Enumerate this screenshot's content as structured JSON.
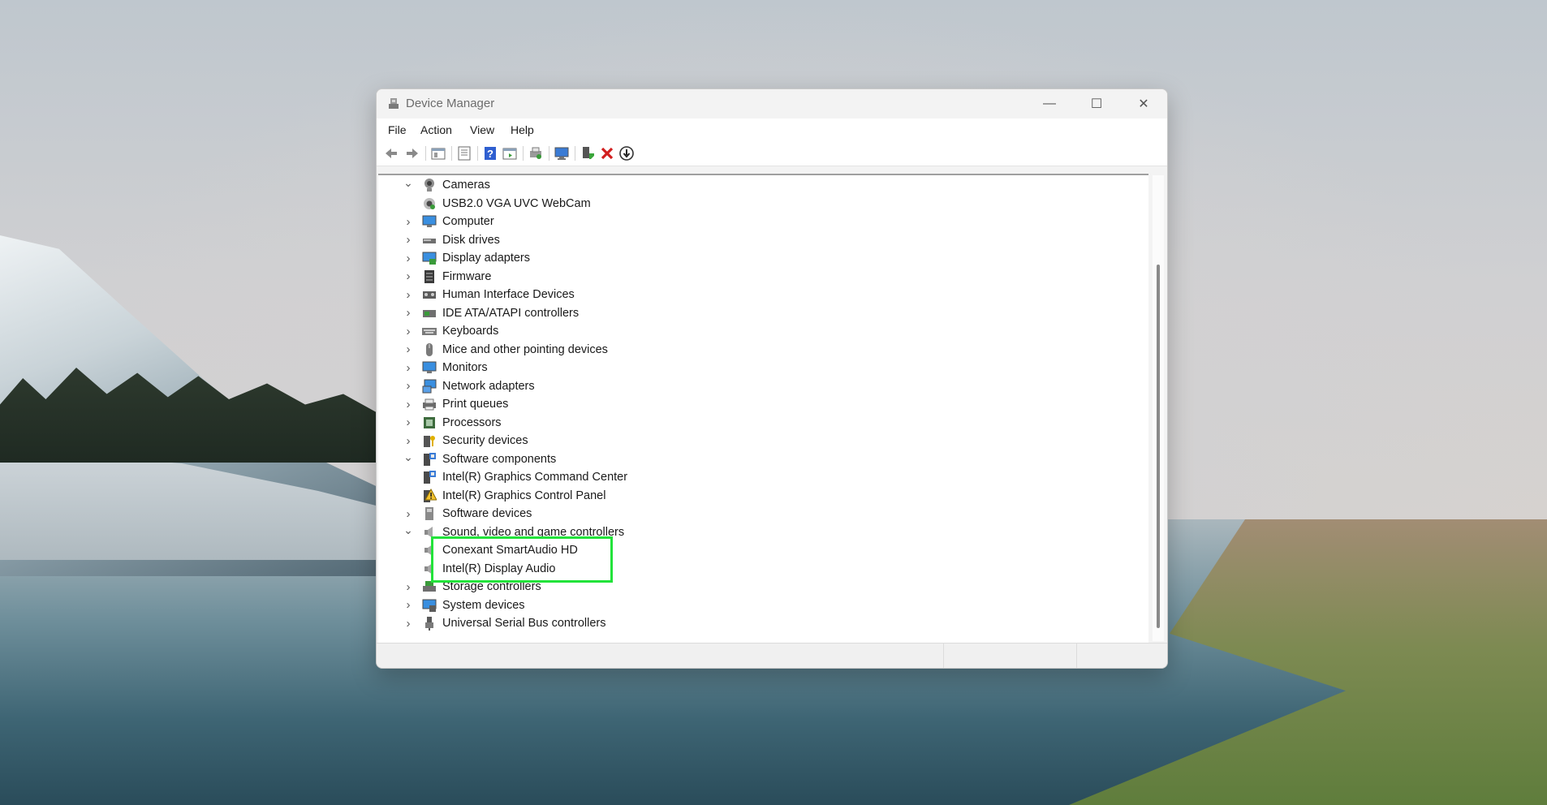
{
  "window": {
    "title": "Device Manager",
    "minimize_glyph": "—",
    "maximize_glyph": "☐",
    "close_glyph": "✕"
  },
  "menu": [
    "File",
    "Action",
    "View",
    "Help"
  ],
  "toolbar": {
    "buttons": [
      "back-arrow-icon",
      "forward-arrow-icon",
      "show-hide-console-tree-icon",
      "properties-icon",
      "help-icon",
      "show-action-pane-icon",
      "print-icon",
      "scan-hardware-icon",
      "update-driver-icon",
      "uninstall-device-icon",
      "disable-device-icon"
    ],
    "colors": {
      "uninstall_red": "#d11f1f"
    }
  },
  "tree": {
    "expanded_glyph": "⌄",
    "collapsed_glyph": "›",
    "items": [
      {
        "label": "Cameras",
        "level": 0,
        "state": "expanded",
        "icon": "camera-icon"
      },
      {
        "label": "USB2.0 VGA UVC WebCam",
        "level": 1,
        "icon": "webcam-icon"
      },
      {
        "label": "Computer",
        "level": 0,
        "state": "collapsed",
        "icon": "computer-icon"
      },
      {
        "label": "Disk drives",
        "level": 0,
        "state": "collapsed",
        "icon": "disk-drive-icon"
      },
      {
        "label": "Display adapters",
        "level": 0,
        "state": "collapsed",
        "icon": "display-adapter-icon"
      },
      {
        "label": "Firmware",
        "level": 0,
        "state": "collapsed",
        "icon": "firmware-icon"
      },
      {
        "label": "Human Interface Devices",
        "level": 0,
        "state": "collapsed",
        "icon": "hid-icon"
      },
      {
        "label": "IDE ATA/ATAPI controllers",
        "level": 0,
        "state": "collapsed",
        "icon": "ide-controller-icon"
      },
      {
        "label": "Keyboards",
        "level": 0,
        "state": "collapsed",
        "icon": "keyboard-icon"
      },
      {
        "label": "Mice and other pointing devices",
        "level": 0,
        "state": "collapsed",
        "icon": "mouse-icon"
      },
      {
        "label": "Monitors",
        "level": 0,
        "state": "collapsed",
        "icon": "monitor-icon"
      },
      {
        "label": "Network adapters",
        "level": 0,
        "state": "collapsed",
        "icon": "network-adapter-icon"
      },
      {
        "label": "Print queues",
        "level": 0,
        "state": "collapsed",
        "icon": "printer-icon"
      },
      {
        "label": "Processors",
        "level": 0,
        "state": "collapsed",
        "icon": "processor-icon"
      },
      {
        "label": "Security devices",
        "level": 0,
        "state": "collapsed",
        "icon": "security-device-icon"
      },
      {
        "label": "Software components",
        "level": 0,
        "state": "expanded",
        "icon": "software-component-icon"
      },
      {
        "label": "Intel(R) Graphics Command Center",
        "level": 1,
        "icon": "software-component-icon"
      },
      {
        "label": "Intel(R) Graphics Control Panel",
        "level": 1,
        "icon": "warning-component-icon"
      },
      {
        "label": "Software devices",
        "level": 0,
        "state": "collapsed",
        "icon": "software-device-icon"
      },
      {
        "label": "Sound, video and game controllers",
        "level": 0,
        "state": "expanded",
        "icon": "speaker-icon"
      },
      {
        "label": "Conexant SmartAudio HD",
        "level": 1,
        "icon": "speaker-icon"
      },
      {
        "label": "Intel(R) Display Audio",
        "level": 1,
        "icon": "speaker-icon"
      },
      {
        "label": "Storage controllers",
        "level": 0,
        "state": "collapsed",
        "icon": "storage-controller-icon"
      },
      {
        "label": "System devices",
        "level": 0,
        "state": "collapsed",
        "icon": "system-device-icon"
      },
      {
        "label": "Universal Serial Bus controllers",
        "level": 0,
        "state": "collapsed",
        "icon": "usb-icon"
      }
    ]
  },
  "highlight": {
    "color": "#22e33a"
  }
}
